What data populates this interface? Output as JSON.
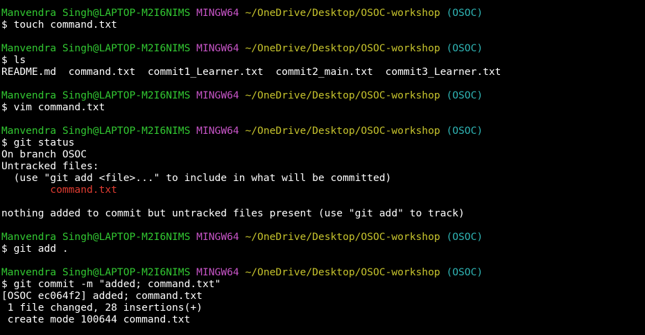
{
  "colors": {
    "background": "#000000",
    "text": "#ffffff",
    "user_host": "#32c932",
    "system": "#c855c8",
    "path": "#c7c42d",
    "branch": "#2fb5b5",
    "untracked": "#e03c31"
  },
  "lines": [
    {
      "type": "prompt",
      "user": "Manvendra Singh@LAPTOP-M2I6NIMS",
      "system": "MINGW64",
      "path": "~/OneDrive/Desktop/OSOC-workshop",
      "branch": "(OSOC)"
    },
    {
      "type": "command",
      "text": "$ touch command.txt"
    },
    {
      "type": "blank",
      "text": ""
    },
    {
      "type": "prompt",
      "user": "Manvendra Singh@LAPTOP-M2I6NIMS",
      "system": "MINGW64",
      "path": "~/OneDrive/Desktop/OSOC-workshop",
      "branch": "(OSOC)"
    },
    {
      "type": "command",
      "text": "$ ls"
    },
    {
      "type": "output",
      "text": "README.md  command.txt  commit1_Learner.txt  commit2_main.txt  commit3_Learner.txt"
    },
    {
      "type": "blank",
      "text": ""
    },
    {
      "type": "prompt",
      "user": "Manvendra Singh@LAPTOP-M2I6NIMS",
      "system": "MINGW64",
      "path": "~/OneDrive/Desktop/OSOC-workshop",
      "branch": "(OSOC)"
    },
    {
      "type": "command",
      "text": "$ vim command.txt"
    },
    {
      "type": "blank",
      "text": ""
    },
    {
      "type": "prompt",
      "user": "Manvendra Singh@LAPTOP-M2I6NIMS",
      "system": "MINGW64",
      "path": "~/OneDrive/Desktop/OSOC-workshop",
      "branch": "(OSOC)"
    },
    {
      "type": "command",
      "text": "$ git status"
    },
    {
      "type": "output",
      "text": "On branch OSOC"
    },
    {
      "type": "output",
      "text": "Untracked files:"
    },
    {
      "type": "output",
      "text": "  (use \"git add <file>...\" to include in what will be committed)"
    },
    {
      "type": "untracked",
      "text": "        command.txt"
    },
    {
      "type": "blank",
      "text": ""
    },
    {
      "type": "output",
      "text": "nothing added to commit but untracked files present (use \"git add\" to track)"
    },
    {
      "type": "blank",
      "text": ""
    },
    {
      "type": "prompt",
      "user": "Manvendra Singh@LAPTOP-M2I6NIMS",
      "system": "MINGW64",
      "path": "~/OneDrive/Desktop/OSOC-workshop",
      "branch": "(OSOC)"
    },
    {
      "type": "command",
      "text": "$ git add ."
    },
    {
      "type": "blank",
      "text": ""
    },
    {
      "type": "prompt",
      "user": "Manvendra Singh@LAPTOP-M2I6NIMS",
      "system": "MINGW64",
      "path": "~/OneDrive/Desktop/OSOC-workshop",
      "branch": "(OSOC)"
    },
    {
      "type": "command",
      "text": "$ git commit -m \"added; command.txt\""
    },
    {
      "type": "output",
      "text": "[OSOC ec064f2] added; command.txt"
    },
    {
      "type": "output",
      "text": " 1 file changed, 28 insertions(+)"
    },
    {
      "type": "output",
      "text": " create mode 100644 command.txt"
    }
  ]
}
